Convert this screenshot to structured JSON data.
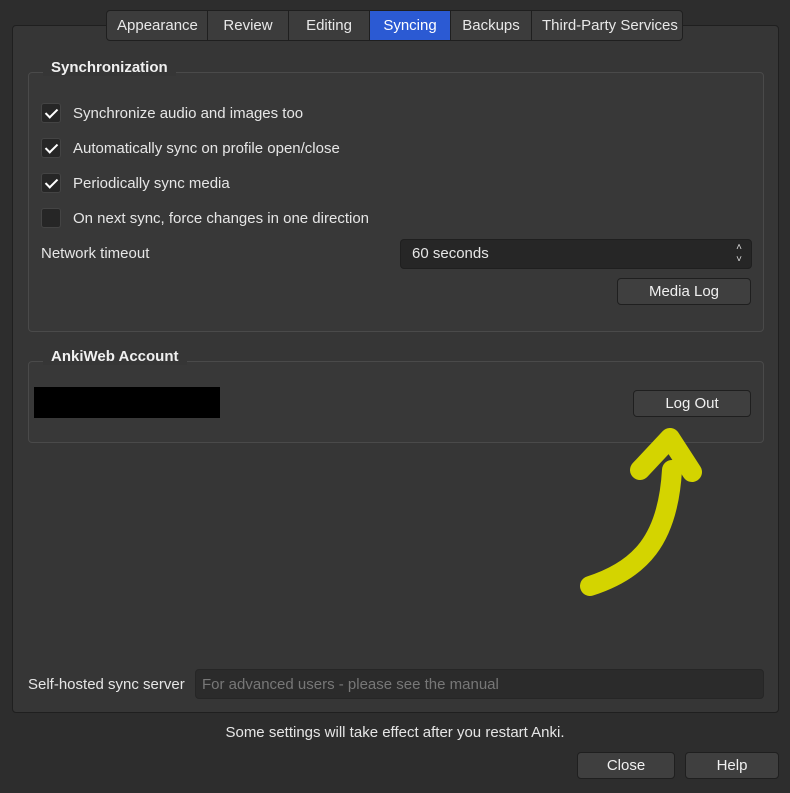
{
  "tabs": [
    "Appearance",
    "Review",
    "Editing",
    "Syncing",
    "Backups",
    "Third-Party Services"
  ],
  "active_tab": "Syncing",
  "sync_group": {
    "title": "Synchronization",
    "options": [
      {
        "label": "Synchronize audio and images too",
        "checked": true
      },
      {
        "label": "Automatically sync on profile open/close",
        "checked": true
      },
      {
        "label": "Periodically sync media",
        "checked": true
      },
      {
        "label": "On next sync, force changes in one direction",
        "checked": false
      }
    ],
    "network_timeout_label": "Network timeout",
    "network_timeout_value": "60 seconds",
    "media_log_button": "Media Log"
  },
  "account_group": {
    "title": "AnkiWeb Account",
    "logout_button": "Log Out"
  },
  "self_hosted": {
    "label": "Self-hosted sync server",
    "placeholder": "For advanced users - please see the manual",
    "value": ""
  },
  "footer": {
    "notice": "Some settings will take effect after you restart Anki.",
    "close_button": "Close",
    "help_button": "Help"
  },
  "colors": {
    "accent": "#2b5ad3",
    "annotation_arrow": "#d4d400"
  }
}
